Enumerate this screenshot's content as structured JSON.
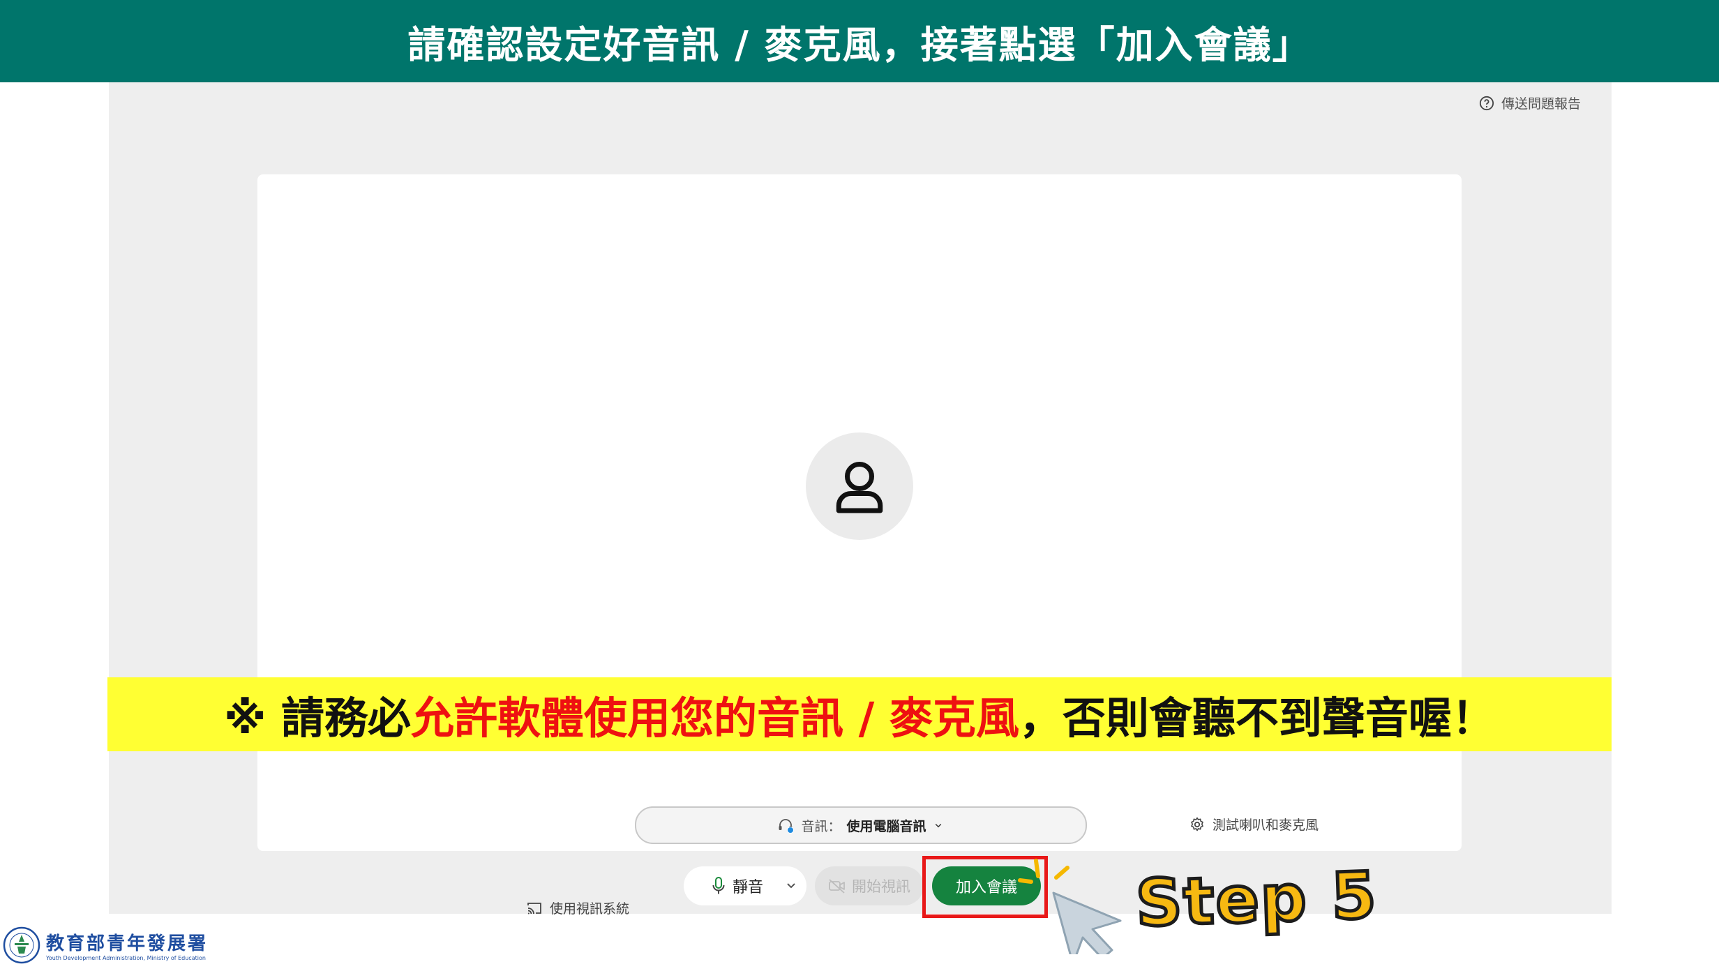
{
  "banner": {
    "title": "請確認設定好音訊 / 麥克風，接著點選「加入會議」"
  },
  "header": {
    "report_label": "傳送問題報告"
  },
  "warning": {
    "prefix": "※ 請務必",
    "highlight": "允許軟體使用您的音訊 / 麥克風",
    "suffix": "，否則會聽不到聲音喔！"
  },
  "options": {
    "cast_label": "使用視訊系統",
    "audio_label": "音訊：",
    "audio_value": "使用電腦音訊",
    "test_label": "測試喇叭和麥克風"
  },
  "controls": {
    "mute_label": "靜音",
    "video_label": "開始視訊",
    "join_label": "加入會議"
  },
  "annotation": {
    "step_label": "Step 5"
  },
  "logo": {
    "name_cn": "教育部青年發展署",
    "name_en": "Youth Development Administration, Ministry of Education"
  },
  "icons": {
    "report": "help-circle-icon",
    "avatar": "user-icon",
    "cast": "cast-icon",
    "headset": "headset-icon",
    "gear": "gear-icon",
    "mic": "microphone-icon",
    "chevron": "chevron-down-icon",
    "video": "video-camera-icon",
    "cursor": "pointer-cursor-icon"
  },
  "colors": {
    "banner": "#00756b",
    "join_button": "#15833f",
    "warning_background": "#ffff33",
    "warning_highlight": "#ee1111",
    "highlight_box": "#e81818",
    "step_text": "#f7b912"
  }
}
